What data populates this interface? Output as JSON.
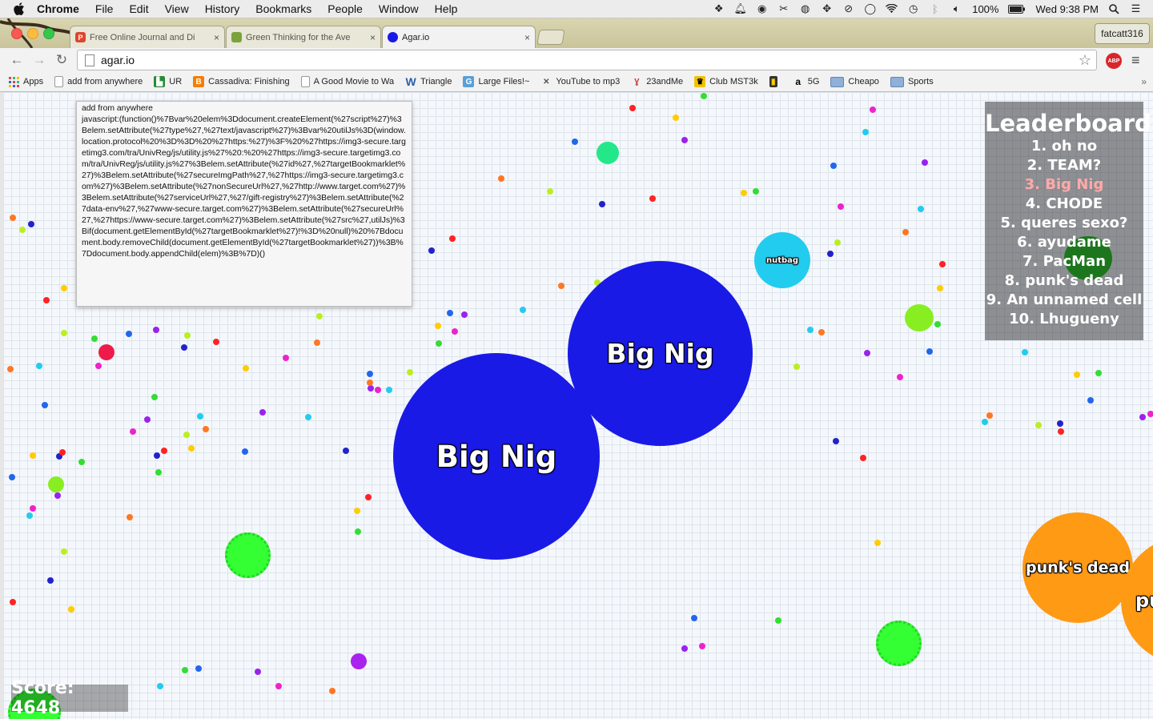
{
  "menubar": {
    "app": "Chrome",
    "items": [
      "File",
      "Edit",
      "View",
      "History",
      "Bookmarks",
      "People",
      "Window",
      "Help"
    ],
    "battery": "100%",
    "clock": "Wed 9:38 PM"
  },
  "tabs": [
    {
      "title": "Free Online Journal and Di",
      "favicon_color": "#e0452d",
      "favicon_letter": "P"
    },
    {
      "title": "Green Thinking for the Ave",
      "favicon_color": "#7aa33c",
      "favicon_letter": ""
    },
    {
      "title": "Agar.io",
      "favicon_color": "#1a1ae6",
      "favicon_letter": ""
    }
  ],
  "profile": "fatcatt316",
  "toolbar": {
    "url": "agar.io"
  },
  "bookmarks": [
    {
      "label": "Apps",
      "icon": "apps-grid"
    },
    {
      "label": "add from anywhere",
      "icon": "page"
    },
    {
      "label": "UR",
      "icon": "ur-logo"
    },
    {
      "label": "Cassadiva: Finishing",
      "icon": "blogger"
    },
    {
      "label": "A Good Movie to Wa",
      "icon": "page"
    },
    {
      "label": "Triangle",
      "icon": "w-logo"
    },
    {
      "label": "Large Files!~",
      "icon": "g-logo"
    },
    {
      "label": "YouTube to mp3",
      "icon": "tools"
    },
    {
      "label": "23andMe",
      "icon": "23andme"
    },
    {
      "label": "Club MST3k",
      "icon": "mst3k"
    },
    {
      "label": "",
      "icon": "device"
    },
    {
      "label": "5G",
      "icon": "amazon"
    },
    {
      "label": "Cheapo",
      "icon": "folder"
    },
    {
      "label": "Sports",
      "icon": "folder"
    }
  ],
  "tooltip": {
    "title": "add from anywhere",
    "body": "javascript:(function()%7Bvar%20elem%3Ddocument.createElement(%27script%27)%3Belem.setAttribute(%27type%27,%27text/javascript%27)%3Bvar%20utilJs%3D(window.location.protocol%20%3D%3D%20%27https:%27)%3F%20%27https://img3-secure.targetimg3.com/tra/UnivReg/js/utility.js%27%20:%20%27https://img3-secure.targetimg3.com/tra/UnivReg/js/utility.js%27%3Belem.setAttribute(%27id%27,%27targetBookmarklet%27)%3Belem.setAttribute(%27secureImgPath%27,%27https://img3-secure.targetimg3.com%27)%3Belem.setAttribute(%27nonSecureUrl%27,%27http://www.target.com%27)%3Belem.setAttribute(%27serviceUrl%27,%27/gift-registry%27)%3Belem.setAttribute(%27data-env%27,%27www-secure.target.com%27)%3Belem.setAttribute(%27secureUrl%27,%27https://www-secure.target.com%27)%3Belem.setAttribute(%27src%27,utilJs)%3Bif(document.getElementById(%27targetBookmarklet%27)!%3D%20null)%20%7Bdocument.body.removeChild(document.getElementById(%27targetBookmarklet%27))%3B%7Ddocument.body.appendChild(elem)%3B%7D)()"
  },
  "game": {
    "leaderboard_title": "Leaderboard",
    "leaderboard": [
      "1. oh no",
      "2. TEAM?",
      "3. Big Nig",
      "4. CHODE",
      "5. queres sexo?",
      "6. ayudame",
      "7. PacMan",
      "8. punk's dead",
      "9. An unnamed cell",
      "10. Lhugueny"
    ],
    "score": "Score: 4648",
    "player_color": "#1a1ae6",
    "cells": [
      {
        "name": "Big Nig",
        "color": "#1a1ae6"
      },
      {
        "name": "Big Nig",
        "color": "#1a1ae6"
      },
      {
        "name": "nutbag",
        "color": "#22ccee"
      },
      {
        "name": "punk's dead",
        "color": "#ff9a14"
      },
      {
        "name": "pu",
        "color": "#ff9a14"
      }
    ]
  }
}
